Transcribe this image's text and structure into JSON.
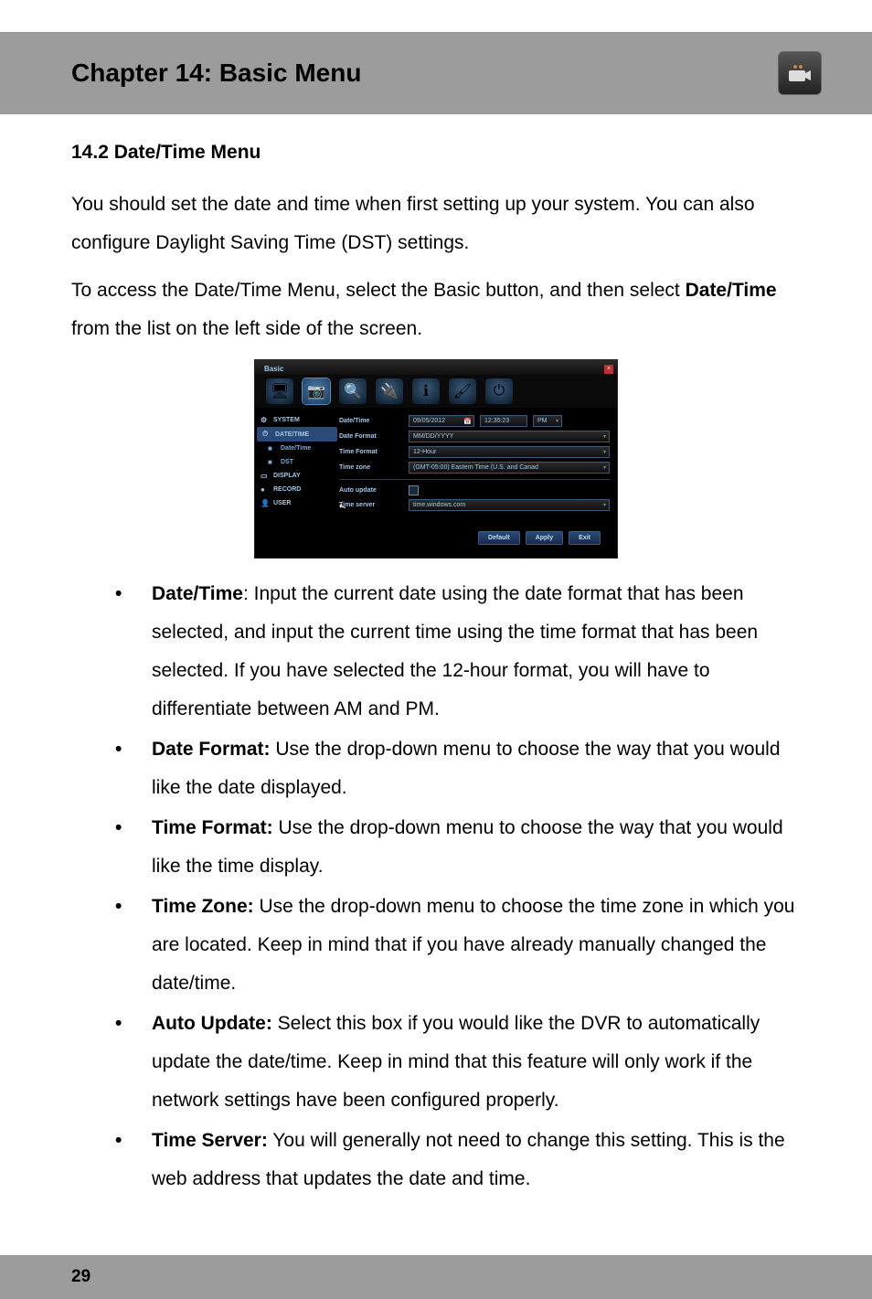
{
  "chapter": {
    "title": "Chapter 14: Basic Menu"
  },
  "section": {
    "heading": "14.2 Date/Time Menu"
  },
  "intro": {
    "p1": "You should set the date and time when first setting up your system. You can also configure Daylight Saving Time (DST) settings.",
    "p2_a": "To access the Date/Time Menu, select the Basic button, and then select ",
    "p2_b": "Date/Time",
    "p2_c": " from the list on the left side of the screen."
  },
  "screenshot": {
    "title": "Basic",
    "tabs": [
      "🖥",
      "📷",
      "🔍",
      "🔌",
      "ℹ",
      "🖌",
      "⏻"
    ],
    "sidebar": [
      {
        "icon": "⚙",
        "label": "SYSTEM"
      },
      {
        "icon": "⏱",
        "label": "DATE/TIME",
        "highlight": true
      },
      {
        "icon": "■",
        "label": "Date/Time",
        "sub": true
      },
      {
        "icon": "■",
        "label": "DST",
        "sub": true
      },
      {
        "icon": "▭",
        "label": "DISPLAY"
      },
      {
        "icon": "●",
        "label": "RECORD"
      },
      {
        "icon": "👤",
        "label": "USER"
      }
    ],
    "rows": {
      "date_label": "Date/Time",
      "date_value": "09/05/2012",
      "time_value": "12:35:23",
      "ampm_value": "PM",
      "dateformat_label": "Date Format",
      "dateformat_value": "MM/DD/YYYY",
      "timeformat_label": "Time Format",
      "timeformat_value": "12-Hour",
      "timezone_label": "Time zone",
      "timezone_value": "(GMT-05:00) Eastern Time (U.S. and Canad",
      "autoupdate_label": "Auto update",
      "timeserver_label": "Time server",
      "timeserver_value": "time.windows.com"
    },
    "buttons": {
      "default": "Default",
      "apply": "Apply",
      "exit": "Exit"
    }
  },
  "bullets": [
    {
      "bold": "Date/Time",
      "rest": ": Input the current date using the date format that has been selected, and input the current time using the time format that has been selected. If you have selected the 12-hour format, you will have to differentiate between AM and PM."
    },
    {
      "bold": "Date Format:",
      "rest": " Use the drop-down menu to choose the way that you would like the date displayed."
    },
    {
      "bold": "Time Format:",
      "rest": " Use the drop-down menu to choose the way that you would like the time display."
    },
    {
      "bold": "Time Zone:",
      "rest": " Use the drop-down menu to choose the time zone in which you are located. Keep in mind that if you have already manually changed the date/time."
    },
    {
      "bold": "Auto Update:",
      "rest": " Select this box if you would like the DVR to automatically update the date/time. Keep in mind that this feature will only work if the network settings have been configured properly."
    },
    {
      "bold": "Time Server:",
      "rest": " You will generally not need to change this setting. This is the web address that updates the date and time."
    }
  ],
  "page_number": "29"
}
